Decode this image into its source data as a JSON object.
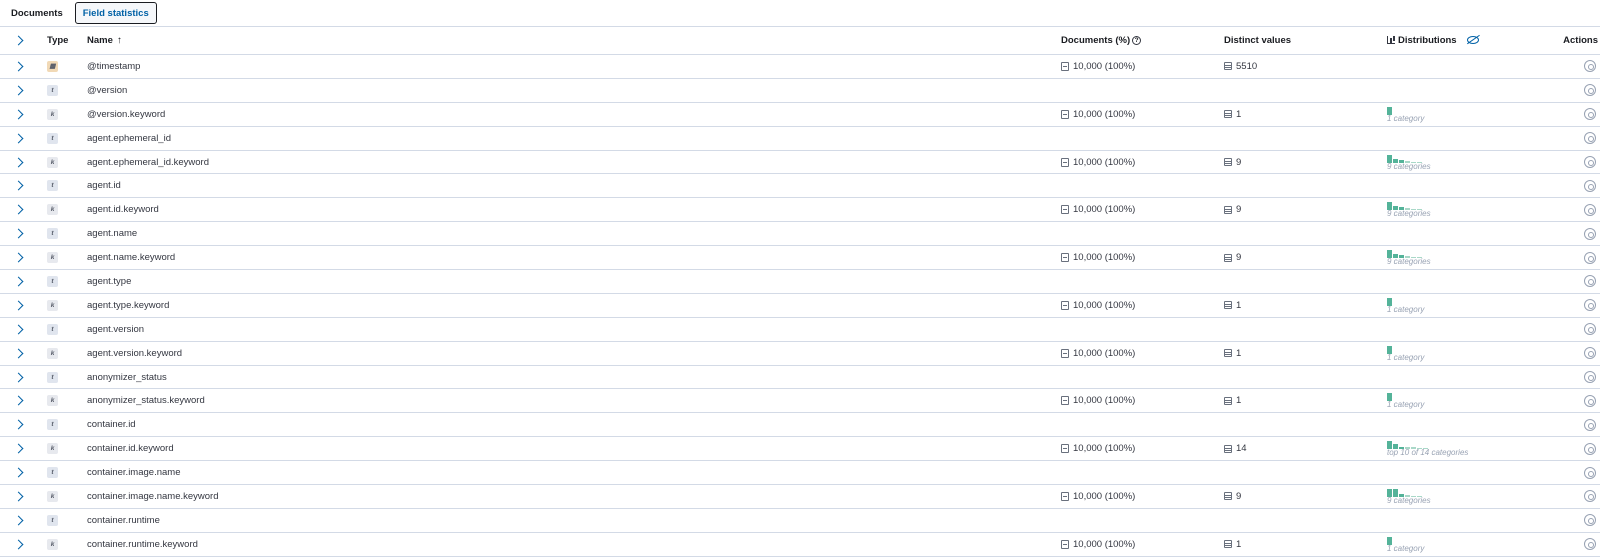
{
  "tabs": [
    {
      "label": "Documents",
      "active": false
    },
    {
      "label": "Field statistics",
      "active": true
    }
  ],
  "columns": {
    "type": "Type",
    "name": "Name",
    "documents": "Documents (%)",
    "distinct": "Distinct values",
    "distributions": "Distributions",
    "actions": "Actions"
  },
  "rows": [
    {
      "type": "date",
      "name": "@timestamp",
      "docs": "10,000 (100%)",
      "distinct": "5510",
      "bars": [],
      "cat": ""
    },
    {
      "type": "text",
      "name": "@version",
      "docs": "",
      "distinct": "",
      "bars": [],
      "cat": ""
    },
    {
      "type": "keyword",
      "name": "@version.keyword",
      "docs": "10,000 (100%)",
      "distinct": "1",
      "bars": [
        1
      ],
      "cat": "1 category"
    },
    {
      "type": "text",
      "name": "agent.ephemeral_id",
      "docs": "",
      "distinct": "",
      "bars": [],
      "cat": ""
    },
    {
      "type": "keyword",
      "name": "agent.ephemeral_id.keyword",
      "docs": "10,000 (100%)",
      "distinct": "9",
      "bars": [
        1,
        0.5,
        0.35,
        0.2,
        0.1,
        0.1
      ],
      "cat": "9 categories"
    },
    {
      "type": "text",
      "name": "agent.id",
      "docs": "",
      "distinct": "",
      "bars": [],
      "cat": ""
    },
    {
      "type": "keyword",
      "name": "agent.id.keyword",
      "docs": "10,000 (100%)",
      "distinct": "9",
      "bars": [
        1,
        0.5,
        0.35,
        0.2,
        0.1,
        0.1
      ],
      "cat": "9 categories"
    },
    {
      "type": "text",
      "name": "agent.name",
      "docs": "",
      "distinct": "",
      "bars": [],
      "cat": ""
    },
    {
      "type": "keyword",
      "name": "agent.name.keyword",
      "docs": "10,000 (100%)",
      "distinct": "9",
      "bars": [
        1,
        0.5,
        0.35,
        0.2,
        0.1,
        0.1
      ],
      "cat": "9 categories"
    },
    {
      "type": "text",
      "name": "agent.type",
      "docs": "",
      "distinct": "",
      "bars": [],
      "cat": ""
    },
    {
      "type": "keyword",
      "name": "agent.type.keyword",
      "docs": "10,000 (100%)",
      "distinct": "1",
      "bars": [
        1
      ],
      "cat": "1 category"
    },
    {
      "type": "text",
      "name": "agent.version",
      "docs": "",
      "distinct": "",
      "bars": [],
      "cat": ""
    },
    {
      "type": "keyword",
      "name": "agent.version.keyword",
      "docs": "10,000 (100%)",
      "distinct": "1",
      "bars": [
        1
      ],
      "cat": "1 category"
    },
    {
      "type": "text",
      "name": "anonymizer_status",
      "docs": "",
      "distinct": "",
      "bars": [],
      "cat": ""
    },
    {
      "type": "keyword",
      "name": "anonymizer_status.keyword",
      "docs": "10,000 (100%)",
      "distinct": "1",
      "bars": [
        1
      ],
      "cat": "1 category"
    },
    {
      "type": "text",
      "name": "container.id",
      "docs": "",
      "distinct": "",
      "bars": [],
      "cat": ""
    },
    {
      "type": "keyword",
      "name": "container.id.keyword",
      "docs": "10,000 (100%)",
      "distinct": "14",
      "bars": [
        1,
        0.6,
        0.3,
        0.2,
        0.2,
        0.15,
        0.1
      ],
      "cat": "top 10 of 14 categories"
    },
    {
      "type": "text",
      "name": "container.image.name",
      "docs": "",
      "distinct": "",
      "bars": [],
      "cat": ""
    },
    {
      "type": "keyword",
      "name": "container.image.name.keyword",
      "docs": "10,000 (100%)",
      "distinct": "9",
      "bars": [
        1,
        1,
        0.4,
        0.2,
        0.1,
        0.1
      ],
      "cat": "9 categories"
    },
    {
      "type": "text",
      "name": "container.runtime",
      "docs": "",
      "distinct": "",
      "bars": [],
      "cat": ""
    },
    {
      "type": "keyword",
      "name": "container.runtime.keyword",
      "docs": "10,000 (100%)",
      "distinct": "1",
      "bars": [
        1
      ],
      "cat": "1 category"
    }
  ]
}
